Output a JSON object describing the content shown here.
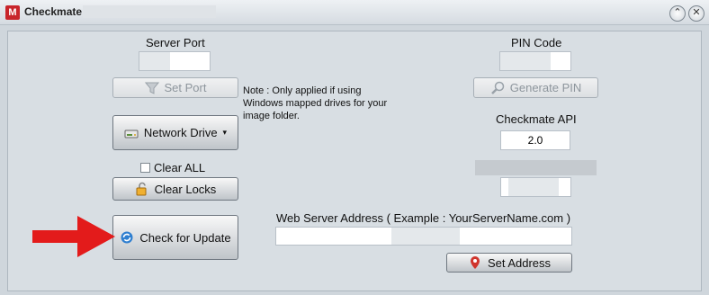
{
  "window": {
    "title": "Checkmate",
    "app_icon_letter": "M",
    "controls": {
      "minimize": "⌃",
      "close": "✕"
    }
  },
  "server_port": {
    "label": "Server Port",
    "value": "",
    "button_label": "Set Port"
  },
  "pin_code": {
    "label": "PIN Code",
    "value": "",
    "button_label": "Generate PIN"
  },
  "network_drive": {
    "button_label": "Network Drive",
    "dropdown_glyph": "▾",
    "note": "Note : Only applied if using Windows mapped drives for your image folder."
  },
  "checkmate_api": {
    "label": "Checkmate API",
    "value": "2.0"
  },
  "clear_all": {
    "label": "Clear ALL",
    "checked": false
  },
  "clear_locks": {
    "button_label": "Clear Locks"
  },
  "check_update": {
    "button_label": "Check for Update"
  },
  "web_server": {
    "label": "Web Server Address ( Example : YourServerName.com )",
    "value": "",
    "button_label": "Set Address"
  },
  "colors": {
    "arrow": "#e31b1b",
    "accent_red": "#d0342c",
    "title_bg": "#e3e8ec"
  },
  "icons": {
    "funnel": "funnel-icon",
    "magnifier": "magnifier-icon",
    "drive": "drive-icon",
    "lock": "lock-icon",
    "refresh": "refresh-icon",
    "map_pin": "map-pin-icon"
  }
}
